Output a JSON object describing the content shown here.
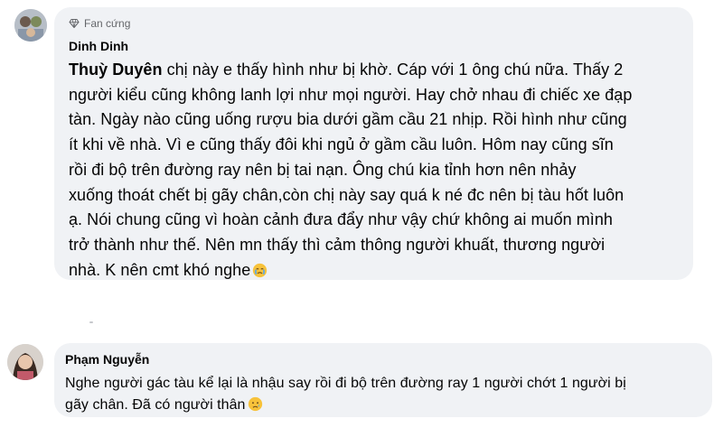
{
  "comments": [
    {
      "badge": "Fan cứng",
      "author": "Dinh Dinh",
      "mention": "Thuỳ Duyên",
      "lines": [
        " chị này e thấy hình như bị khờ. Cáp với 1 ông chú nữa. Thấy 2",
        "người kiểu cũng không lanh lợi như mọi người. Hay chở nhau đi chiếc xe đạp",
        "tàn. Ngày nào cũng uống rượu bia dưới gầm cầu 21 nhịp. Rồi hình như cũng",
        "ít khi về nhà. Vì e cũng thấy đôi khi ngủ ở gầm cầu luôn. Hôm nay cũng sĩn",
        "rồi đi bộ trên đường ray nên bị tai nạn. Ông chú kia tỉnh hơn nên nhảy",
        "xuống thoát chết bị gãy chân,còn chị này say quá k né đc nên bị tàu hốt luôn",
        "ạ. Nói chung cũng vì hoàn cảnh đưa đẩy như vậy chứ không ai muốn mình",
        "trở thành như thế. Nên mn thấy thì cảm thông người khuất, thương người",
        "nhà. K nên cmt khó nghe"
      ],
      "emoji": "crying-face-emoji"
    },
    {
      "author": "Phạm Nguyễn",
      "lines": [
        "Nghe người gác tàu kể lại là nhậu say rồi đi bộ trên đường ray 1 người chớt 1 người bị",
        "gãy chân. Đã có người thân"
      ],
      "emoji": "sad-face-emoji"
    }
  ],
  "colors": {
    "bubble": "#f0f2f5",
    "text": "#050505",
    "meta": "#65676b"
  }
}
